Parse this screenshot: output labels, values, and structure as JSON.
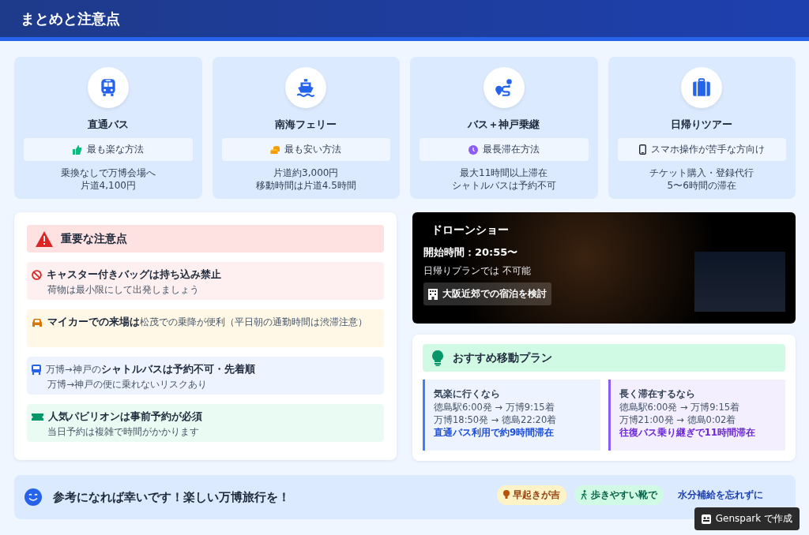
{
  "header": {
    "title": "まとめと注意点"
  },
  "methods": [
    {
      "title": "直通バス",
      "tag": "最も楽な方法",
      "lines": [
        "乗換なしで万博会場へ",
        "片道4,100円"
      ]
    },
    {
      "title": "南海フェリー",
      "tag": "最も安い方法",
      "lines": [
        "片道約3,000円",
        "移動時間は片道4.5時間"
      ]
    },
    {
      "title": "バス＋神戸乗継",
      "tag": "最長滞在方法",
      "lines": [
        "最大11時間以上滞在",
        "シャトルバスは予約不可"
      ]
    },
    {
      "title": "日帰りツアー",
      "tag": "スマホ操作が苦手な方向け",
      "lines": [
        "チケット購入・登録代行",
        "5〜6時間の滞在"
      ]
    }
  ],
  "warnings": {
    "title": "重要な注意点",
    "items": [
      {
        "kind": "danger",
        "title": "キャスター付きバッグは持ち込み禁止",
        "detail": "荷物は最小限にして出発しましょう"
      },
      {
        "kind": "warning",
        "title": "マイカーでの来場は",
        "suffix": "松茂での乗降が便利（平日朝の通勤時間は渋滞注意）"
      },
      {
        "kind": "info",
        "prefix": "万博→神戸の",
        "title": "シャトルバスは予約不可・先着順",
        "detail": "万博→神戸の便に乗れないリスクあり"
      },
      {
        "kind": "success",
        "title": "人気パビリオンは事前予約が必須",
        "detail": "当日予約は複雑で時間がかかります"
      }
    ]
  },
  "drone_show": {
    "title": "ドローンショー",
    "start": "開始時間：20:55〜",
    "note": "日帰りプランでは 不可能",
    "action": "大阪近郊での宿泊を検討"
  },
  "plans": {
    "title": "おすすめ移動プラン",
    "items": [
      {
        "kind": "easy",
        "title": "気楽に行くなら",
        "lines": [
          "徳島駅6:00発 → 万博9:15着",
          "万博18:50発 → 徳島22:20着"
        ],
        "summary": "直通バス利用で約9時間滞在"
      },
      {
        "kind": "long",
        "title": "長く滞在するなら",
        "lines": [
          "徳島駅6:00発 → 万博9:15着",
          "万博21:00発 → 徳島0:02着"
        ],
        "summary": "往復バス乗り継ぎで11時間滞在"
      }
    ]
  },
  "footer": {
    "message": "参考になれば幸いです！楽しい万博旅行を！",
    "tags": [
      {
        "kind": "yellow",
        "text": "早起きが吉"
      },
      {
        "kind": "green",
        "text": "歩きやすい靴で"
      },
      {
        "kind": "blue",
        "text": "水分補給を忘れずに"
      }
    ]
  },
  "badge": {
    "text": "Genspark で作成"
  }
}
